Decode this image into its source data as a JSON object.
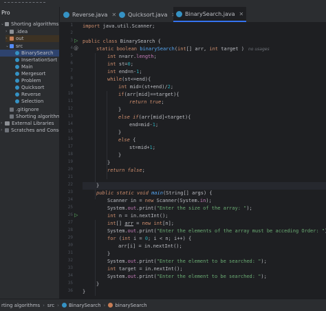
{
  "app": {
    "project_title": "Pro"
  },
  "tabs": [
    {
      "label": "Reverse.java",
      "active": false
    },
    {
      "label": "Quicksort.java",
      "active": false
    },
    {
      "label": "BinarySearch.java",
      "active": true
    }
  ],
  "tree": [
    {
      "label": "Shorting algorithms",
      "icon": "folder-icon"
    },
    {
      "label": ".idea",
      "icon": "folder-icon"
    },
    {
      "label": "out",
      "icon": "folder-icon"
    },
    {
      "label": "src",
      "icon": "folder-icon"
    },
    {
      "label": "BinarySearch",
      "icon": "class-icon"
    },
    {
      "label": "InsertationSort",
      "icon": "class-icon"
    },
    {
      "label": "Main",
      "icon": "class-icon"
    },
    {
      "label": "Mergesort",
      "icon": "class-icon"
    },
    {
      "label": "Problem",
      "icon": "class-icon"
    },
    {
      "label": "Quicksort",
      "icon": "class-icon"
    },
    {
      "label": "Reverse",
      "icon": "class-icon"
    },
    {
      "label": "Selection",
      "icon": "class-icon"
    },
    {
      "label": ".gitignore",
      "icon": "file-icon"
    },
    {
      "label": "Shorting algorithms",
      "icon": "file-icon"
    },
    {
      "label": "External Libraries",
      "icon": "library-icon"
    },
    {
      "label": "Scratches and Console",
      "icon": "scratch-icon"
    }
  ],
  "line_numbers": [
    "1",
    "2",
    "3",
    "4",
    "5",
    "6",
    "7",
    "8",
    "9",
    "10",
    "11",
    "12",
    "13",
    "14",
    "15",
    "16",
    "17",
    "18",
    "19",
    "20",
    "21",
    "22",
    "23",
    "24",
    "25",
    "26",
    "27",
    "28",
    "29",
    "30",
    "31",
    "32",
    "33",
    "34",
    "35",
    "36"
  ],
  "code": {
    "l1_kw": "import",
    "l1_rest": " java.util.Scanner;",
    "l3_kw": "public class",
    "l3_rest": " BinarySearch {",
    "l4_kw": "static boolean",
    "l4_name": " binarySearch",
    "l4_args_a": "(",
    "l4_kw2": "int",
    "l4_args_b": "[] arr, ",
    "l4_kw3": "int",
    "l4_args_c": " target )",
    "l4_hint": "no usages",
    "l5_kw": "int",
    "l5_rest": " n=arr.",
    "l5_f": "length",
    "l5_end": ";",
    "l6_kw": "int",
    "l6_rest": " st=",
    "l6_n": "0",
    "l6_end": ";",
    "l7_kw": "int",
    "l7_rest": " end=n-",
    "l7_n": "1",
    "l7_end": ";",
    "l8_kw": "while",
    "l8_rest": "(st<=end){",
    "l9_kw": "int",
    "l9_rest": " mid=(st+end)/",
    "l9_n": "2",
    "l9_end": ";",
    "l10_kw": "if",
    "l10_rest": "(arr[mid]==target){",
    "l11_kw": "return",
    "l11_kw2": "true",
    "l11_end": ";",
    "l12": "}",
    "l13_kw": "else if",
    "l13_rest": "(arr[mid]<target){",
    "l14_rest": "end=mid-",
    "l14_n": "1",
    "l14_end": ";",
    "l15": "}",
    "l16_kw": "else",
    "l16_rest": " {",
    "l17_rest": "st=mid+",
    "l17_n": "1",
    "l17_end": ";",
    "l18": "}",
    "l19": "}",
    "l20_kw": "return",
    "l20_kw2": "false",
    "l20_end": ";",
    "l22": "}",
    "l23_kw": "public static void",
    "l23_name": " main",
    "l23_rest": "(String[] args) {",
    "l24_rest": "Scanner in = ",
    "l24_kw": "new",
    "l24_rest2": " Scanner(System.",
    "l24_f": "in",
    "l24_end": ");",
    "l25_a": "System.",
    "l25_f": "out",
    "l25_b": ".print(",
    "l25_s": "\"Enter the size of the array: \"",
    "l25_end": ");",
    "l26_kw": "int",
    "l26_rest": " n = in.nextInt();",
    "l27_kw": "int",
    "l27_a": "[] ",
    "l27_u": "arr",
    "l27_b": " = ",
    "l27_kw2": "new int",
    "l27_c": "[n];",
    "l28_a": "System.",
    "l28_f": "out",
    "l28_b": ".print(",
    "l28_s": "\"Enter the elements of the array must be acceding Order: \"",
    "l28_end": ");",
    "l29_kw": "for",
    "l29_a": " (",
    "l29_kw2": "int",
    "l29_b": " i = ",
    "l29_n": "0",
    "l29_c": "; i < n; i++) {",
    "l30_rest": "arr[i] = in.nextInt();",
    "l31": "}",
    "l32_a": "System.",
    "l32_f": "out",
    "l32_b": ".print(",
    "l32_s": "\"Enter the element to be searched: \"",
    "l32_end": ");",
    "l33_kw": "int",
    "l33_rest": " target = in.nextInt();",
    "l34_a": "System.",
    "l34_f": "out",
    "l34_b": ".print(",
    "l34_s": "\"Enter the element to be searched: \"",
    "l34_end": ");",
    "l35": "}",
    "l36": "}"
  },
  "status": {
    "crumbs": [
      "rting algorithms",
      "src",
      "BinarySearch",
      "binarySearch"
    ]
  },
  "colors": {
    "accent": "#3574f0",
    "keyword": "#cf8e6d",
    "method": "#56a8f5",
    "string": "#6aab73",
    "number": "#2aacb8",
    "field": "#c77dbb"
  }
}
